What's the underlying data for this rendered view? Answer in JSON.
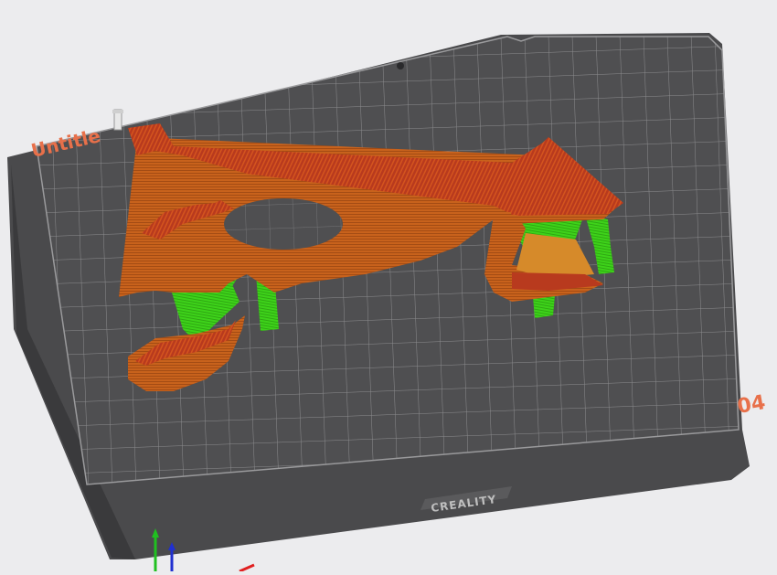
{
  "viewport": {
    "plate_name": "Untitle",
    "plate_number": "04",
    "bed_brand": "CREALITY"
  },
  "colors": {
    "background": "#ececee",
    "bed": "#4a4a4c",
    "grid": "#8a8a8c",
    "print_wall": "#c8621c",
    "print_top_infill": "#b83a1e",
    "support": "#3ed21a",
    "plate_label": "#e8704a",
    "axis_x": "#e02020",
    "axis_y": "#20c020",
    "axis_z": "#2030d0"
  },
  "icons": {
    "axes": "axes-gizmo-icon"
  }
}
